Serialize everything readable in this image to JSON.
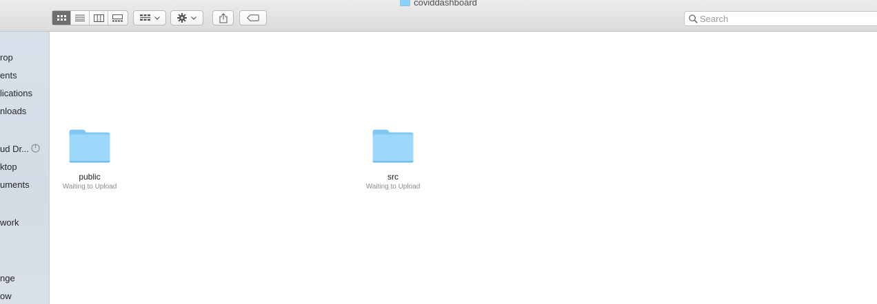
{
  "window": {
    "title": "coviddashboard"
  },
  "toolbar": {
    "view_modes": [
      "icon-view",
      "list-view",
      "column-view",
      "gallery-view"
    ],
    "active_view": "icon-view",
    "arrange_icon": "group-by-icon",
    "action_icon": "gear-icon",
    "share_icon": "share-icon",
    "tags_icon": "tag-icon"
  },
  "search": {
    "placeholder": "Search",
    "value": ""
  },
  "sidebar": {
    "items": [
      {
        "label": "rop"
      },
      {
        "label": "ents"
      },
      {
        "label": "lications"
      },
      {
        "label": "nloads"
      },
      {
        "label": "ud Dr..."
      },
      {
        "label": "ktop"
      },
      {
        "label": "uments"
      },
      {
        "label": "work"
      },
      {
        "label": "nge"
      },
      {
        "label": "ow"
      }
    ]
  },
  "files": [
    {
      "name": "public",
      "status": "Waiting to Upload"
    },
    {
      "name": "src",
      "status": "Waiting to Upload"
    }
  ],
  "colors": {
    "folder": "#8fd0f7",
    "active_segment": "#6e6e6e",
    "sidebar_bg": "#d7e1ea"
  }
}
